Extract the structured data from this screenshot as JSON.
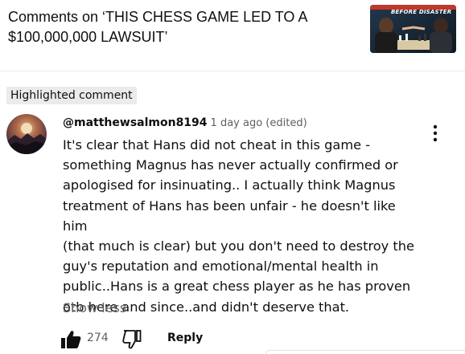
{
  "header": {
    "title": "Comments on ‘THIS CHESS GAME LED TO A $100,000,000 LAWSUIT’",
    "thumbnail_caption": "BEFORE DISASTER"
  },
  "highlight_badge": "Highlighted comment",
  "comment": {
    "author": "@matthewsalmon8194",
    "timestamp": "1 day ago (edited)",
    "text": "It's clear that Hans did not cheat in this game -\nsomething Magnus has never actually confirmed or\napologised for insinuating..  I actually think Magnus\ntreatment of Hans has been unfair - he doesn't like him\n(that much is clear) but you don't need to destroy the\nguy's reputation and emotional/mental health in\npublic..Hans is a great chess player as he has proven\notb here and since..and didn't deserve that.",
    "show_less_label": "Show less",
    "like_count": "274",
    "reply_label": "Reply"
  },
  "icons": {
    "more": "vertical-ellipsis-icon",
    "like": "thumbs-up-filled-icon",
    "dislike": "thumbs-down-outline-icon"
  },
  "colors": {
    "primary_text": "#0f0f0f",
    "secondary_text": "#606060",
    "badge_background": "#ebebeb"
  }
}
